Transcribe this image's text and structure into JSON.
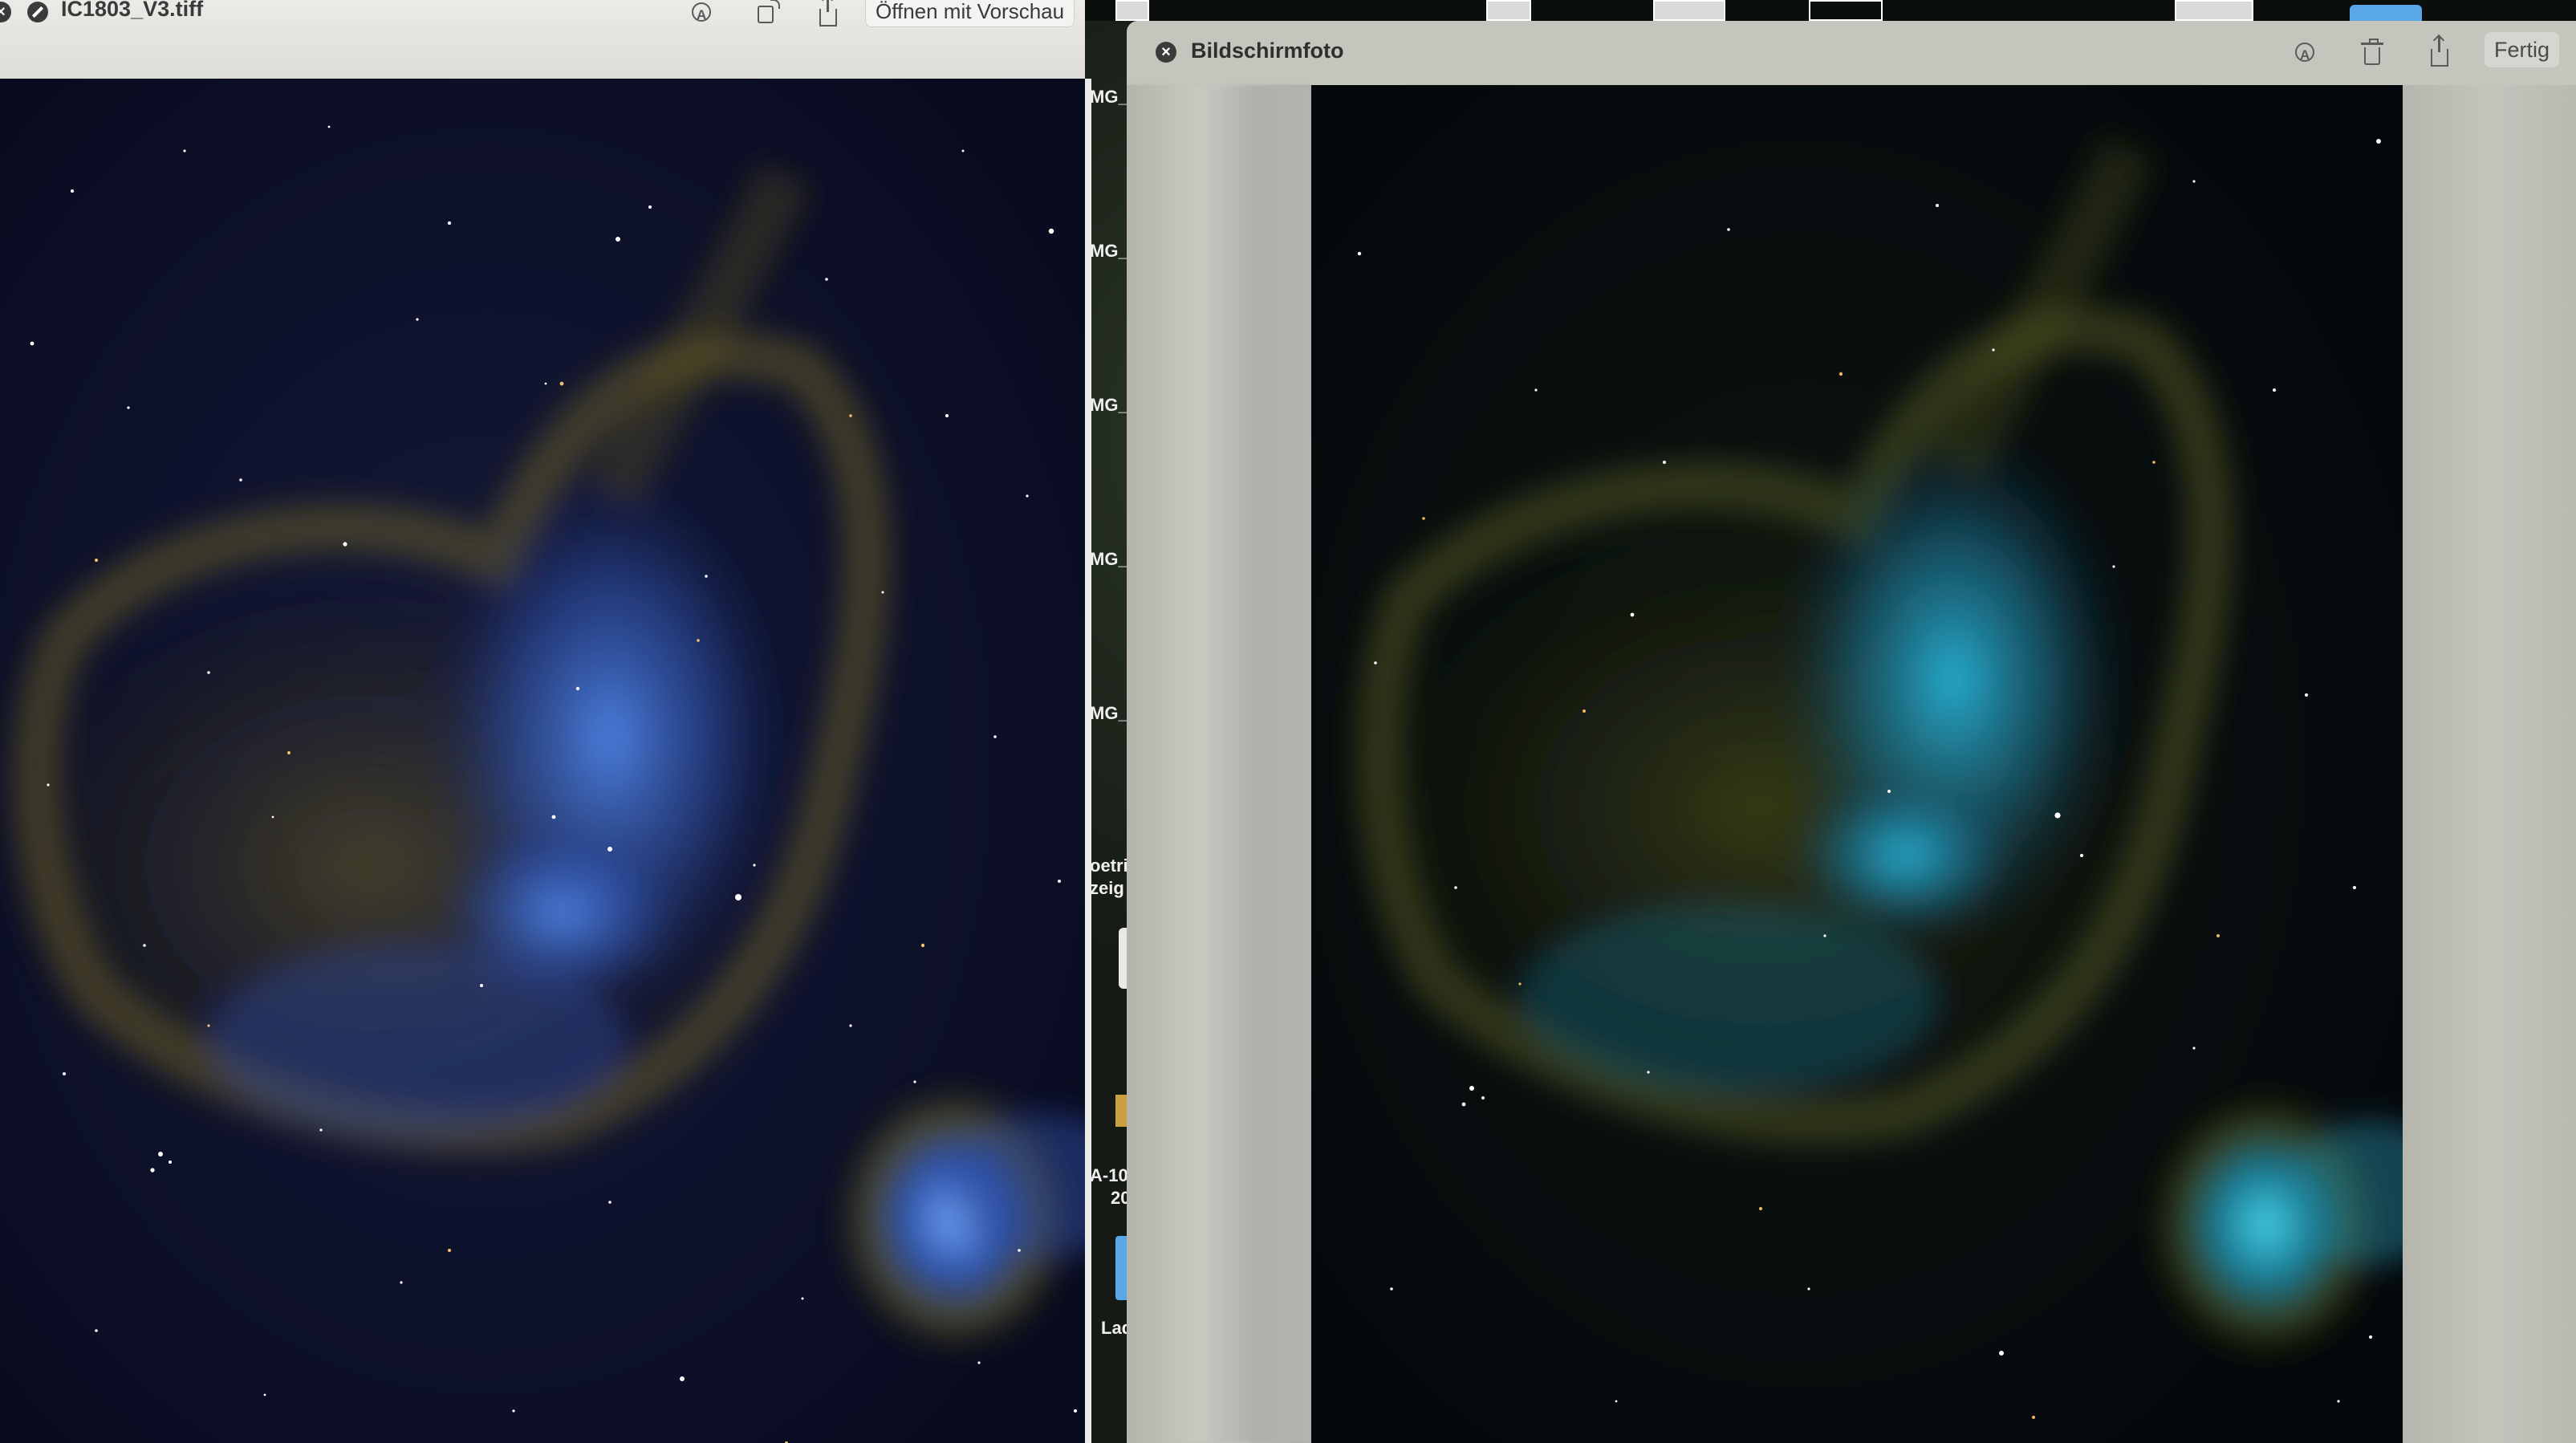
{
  "left_window": {
    "title": "IC1803_V3.tiff",
    "open_button": "Öffnen mit Vorschau",
    "icons": [
      "close-icon",
      "hide-icon",
      "annotate-icon",
      "rotate-icon",
      "share-icon"
    ]
  },
  "right_window": {
    "title": "Bildschirmfoto",
    "done_button": "Fertig",
    "icons": [
      "close-icon",
      "annotate-icon",
      "trash-icon",
      "share-icon"
    ]
  },
  "finder_labels": [
    "MG_",
    "MG_",
    "MG_",
    "MG_",
    "MG_",
    "oetri",
    "zeig",
    "A-10",
    "20",
    "Lad"
  ],
  "colors": {
    "titlebar_left": "#e4e3e0",
    "titlebar_right": "#c5c4bd",
    "nebula_left_core": "#3f6fd0",
    "nebula_right_core": "#1fa6c8",
    "nebula_dust": "#8a7a2a"
  }
}
